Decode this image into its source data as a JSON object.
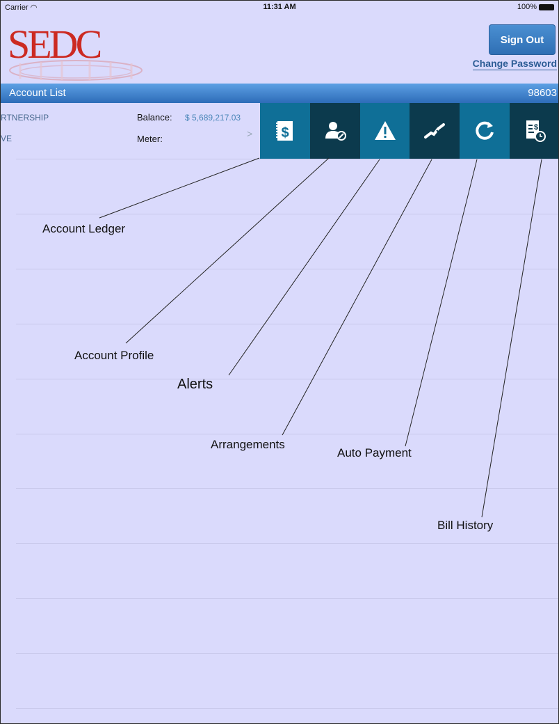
{
  "status_bar": {
    "carrier": "Carrier",
    "time": "11:31 AM",
    "battery": "100%"
  },
  "header": {
    "logo_text": "SEDC",
    "sign_out_label": "Sign Out",
    "change_password_label": "Change Password"
  },
  "nav": {
    "back_label": "Account List",
    "account_number": "98603"
  },
  "account": {
    "name_partial": "RTNERSHIP",
    "address_partial": "VE",
    "balance_label": "Balance:",
    "balance_value": "$ 5,689,217.03",
    "meter_label": "Meter:",
    "chevron": ">"
  },
  "toolbar": {
    "buttons": [
      {
        "icon": "account-ledger-icon"
      },
      {
        "icon": "account-profile-icon"
      },
      {
        "icon": "alerts-icon"
      },
      {
        "icon": "arrangements-icon"
      },
      {
        "icon": "auto-payment-icon"
      },
      {
        "icon": "bill-history-icon"
      }
    ]
  },
  "callouts": {
    "account_ledger": "Account Ledger",
    "account_profile": "Account Profile",
    "alerts": "Alerts",
    "arrangements": "Arrangements",
    "auto_payment": "Auto Payment",
    "bill_history": "Bill History"
  },
  "colors": {
    "background": "#dadafc",
    "nav_bar": "#2d6cb8",
    "toolbar_light": "#0f6f97",
    "toolbar_dark": "#0c3a4d",
    "logo_red": "#cc2a22",
    "button_blue": "#3a7fc4"
  }
}
